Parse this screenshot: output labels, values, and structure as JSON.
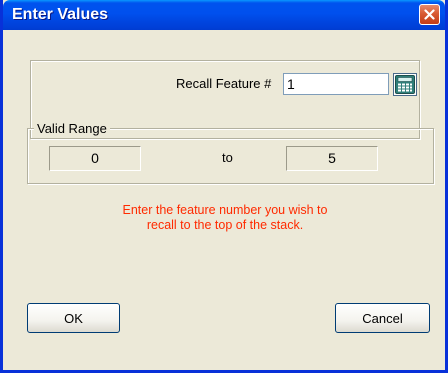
{
  "window": {
    "title": "Enter Values"
  },
  "recall": {
    "label": "Recall Feature #",
    "value": "1"
  },
  "range": {
    "legend": "Valid Range",
    "from": "0",
    "to_label": "to",
    "to": "5"
  },
  "hint": {
    "line1": "Enter the feature number you wish to",
    "line2": "recall to the top of the stack."
  },
  "buttons": {
    "ok": "OK",
    "cancel": "Cancel"
  },
  "colors": {
    "titlebar": "#0053ee",
    "dialog_bg": "#ece9d8",
    "hint_text": "#ff2a00",
    "close_button": "#d85b33"
  },
  "icons": {
    "close": "close-icon",
    "calculator": "calculator-icon"
  }
}
